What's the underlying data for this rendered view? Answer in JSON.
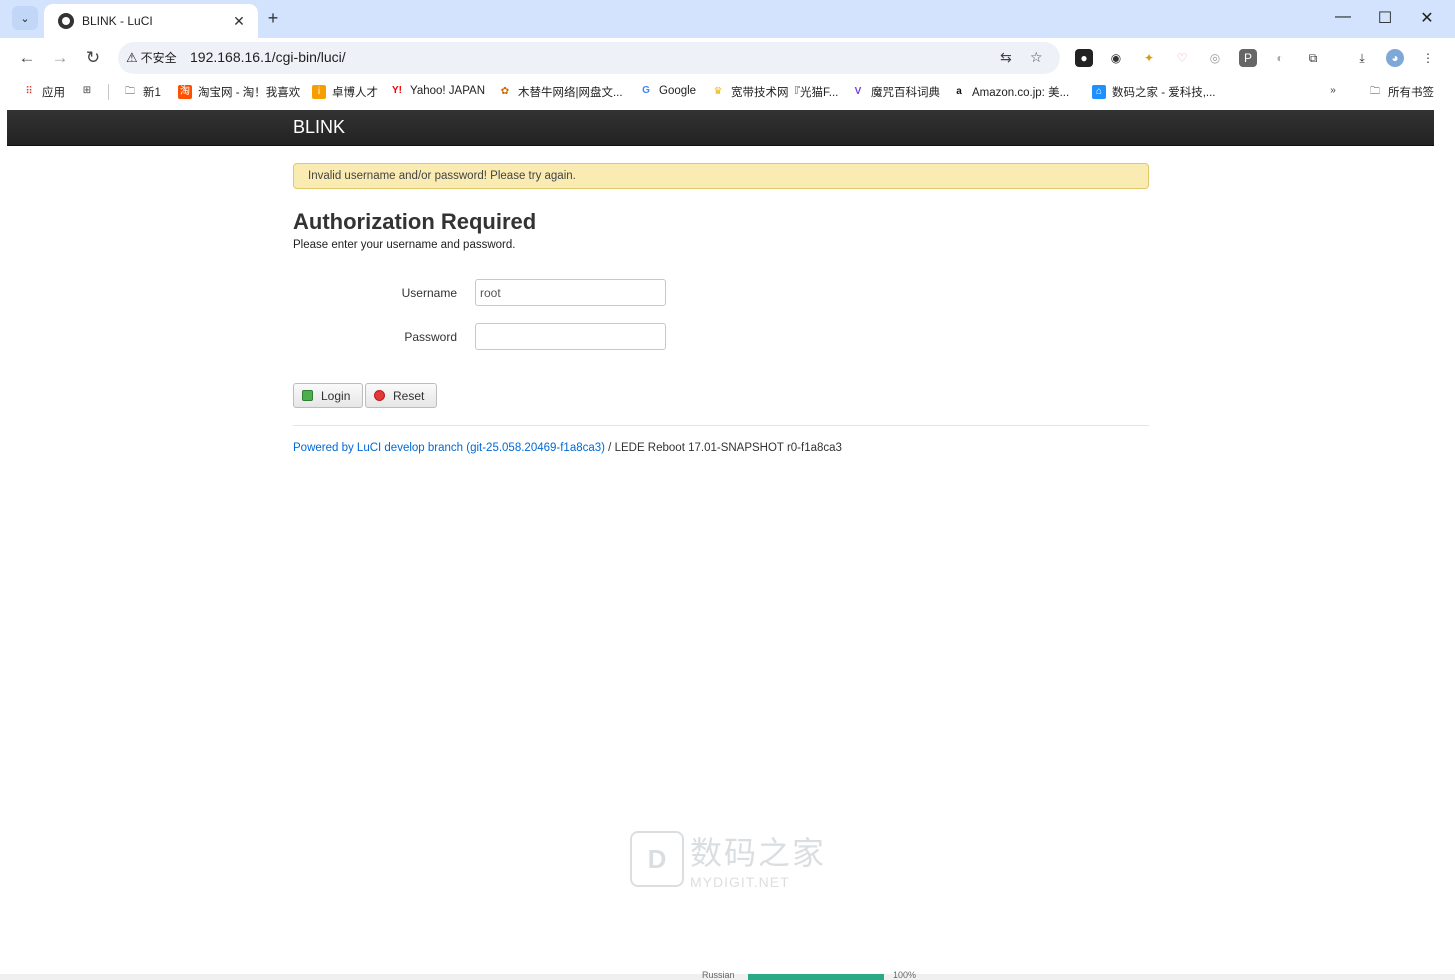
{
  "browser": {
    "tab_title": "BLINK - LuCI",
    "url": "192.168.16.1/cgi-bin/luci/",
    "security_label": "不安全",
    "bookmarks": [
      {
        "label": "应用"
      },
      {
        "label": "新1"
      },
      {
        "label": "淘宝网 - 淘！我喜欢"
      },
      {
        "label": "卓博人才"
      },
      {
        "label": "Yahoo! JAPAN"
      },
      {
        "label": "木替牛网络|网盘文..."
      },
      {
        "label": "Google"
      },
      {
        "label": "宽带技术网『光猫F..."
      },
      {
        "label": "魔咒百科词典"
      },
      {
        "label": "Amazon.co.jp: 美..."
      },
      {
        "label": "数码之家 - 爱科技,..."
      }
    ],
    "all_bookmarks_label": "所有书签"
  },
  "page": {
    "brand": "BLINK",
    "alert": "Invalid username and/or password! Please try again.",
    "heading": "Authorization Required",
    "description": "Please enter your username and password.",
    "username_label": "Username",
    "username_value": "root",
    "password_label": "Password",
    "password_value": "",
    "login_label": "Login",
    "reset_label": "Reset",
    "footer_link": "Powered by LuCI develop branch (git-25.058.20469-f1a8ca3)",
    "footer_text": " / LEDE Reboot 17.01-SNAPSHOT r0-f1a8ca3"
  },
  "watermark": {
    "cn": "数码之家",
    "en": "MYDIGIT.NET"
  },
  "background_strip": {
    "language": "Russian",
    "percent": "100%"
  },
  "colors": {
    "titlebar": "#d3e3fd",
    "brandbar": "#2a2a2a",
    "alert_bg": "#f9ebb2",
    "link": "#0069d6"
  }
}
